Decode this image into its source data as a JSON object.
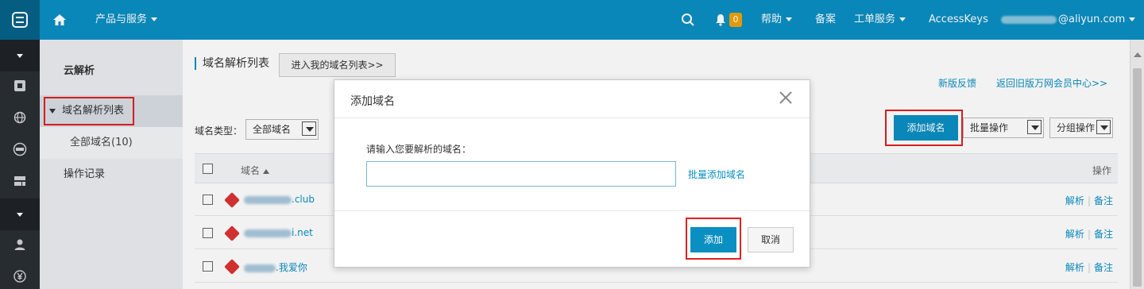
{
  "topbar": {
    "products_label": "产品与服务",
    "notifications_count": "0",
    "help_label": "帮助",
    "beian_label": "备案",
    "ticket_label": "工单服务",
    "accesskeys_label": "AccessKeys",
    "account_email_suffix": "@aliyun.com"
  },
  "sidebar": {
    "title": "云解析",
    "items": [
      {
        "label": "域名解析列表"
      },
      {
        "label": "全部域名(10)"
      },
      {
        "label": "操作记录"
      }
    ]
  },
  "main": {
    "page_title": "域名解析列表",
    "goto_domain_list_button": "进入我的域名列表>>",
    "feedback_link": "新版反馈",
    "old_member_link": "返回旧版万网会员中心>>",
    "filter_label": "域名类型：",
    "filter_value": "全部域名",
    "add_domain_button": "添加域名",
    "batch_ops_value": "批量操作",
    "group_ops_value": "分组操作",
    "table": {
      "col_domain": "域名",
      "col_ops": "操作",
      "rows": [
        {
          "domain_suffix": ".club",
          "resolve": "解析",
          "note": "备注"
        },
        {
          "domain_suffix": "i.net",
          "resolve": "解析",
          "note": "备注"
        },
        {
          "domain_suffix": ".我爱你",
          "resolve": "解析",
          "note": "备注"
        }
      ]
    }
  },
  "modal": {
    "title": "添加域名",
    "prompt": "请输入您要解析的域名：",
    "input_value": "",
    "input_placeholder": "",
    "batch_add_link": "批量添加域名",
    "confirm_button": "添加",
    "cancel_button": "取消"
  },
  "colors": {
    "topbar": "#0a8fc2",
    "primary": "#0a8fc2",
    "highlight": "#e02020",
    "badge": "#f0a30a"
  }
}
